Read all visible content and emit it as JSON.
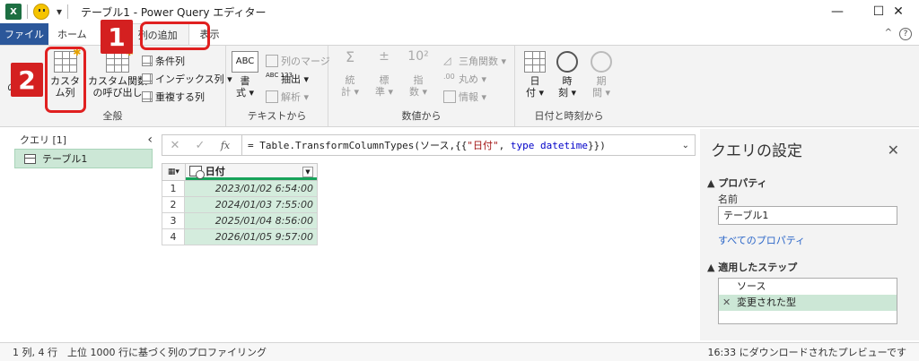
{
  "window": {
    "title": "テーブル1 - Power Query エディター",
    "app_icon_label": "X",
    "minimize": "—",
    "maximize": "☐",
    "close": "✕"
  },
  "tabs": [
    {
      "label": "ファイル"
    },
    {
      "label": "ホーム"
    },
    {
      "label": "列の追加"
    },
    {
      "label": "表示"
    }
  ],
  "ribbon": {
    "general": {
      "label": "全般",
      "col_from_examples_fragment": "の列",
      "custom_column": "カスタ\nム列",
      "invoke_custom_function": "カスタム関数\nの呼び出し",
      "conditional_column": "条件列",
      "index_column": "インデックス列 ▾",
      "duplicate_column": "重複する列"
    },
    "text": {
      "label": "テキストから",
      "format": "書\n式 ▾",
      "merge_columns": "列のマージ",
      "extract": "抽出 ▾",
      "parse": "解析 ▾"
    },
    "number": {
      "label": "数値から",
      "statistics": "統\n計 ▾",
      "standard": "標\n準 ▾",
      "scientific": "指\n数 ▾",
      "trigonometry": "三角関数 ▾",
      "rounding": "丸め ▾",
      "information": "情報 ▾"
    },
    "datetime": {
      "label": "日付と時刻から",
      "date": "日\n付 ▾",
      "time": "時\n刻 ▾",
      "duration": "期\n間 ▾"
    }
  },
  "annotations": {
    "badge1": "1",
    "badge2": "2"
  },
  "queries": {
    "header": "クエリ [1]",
    "collapse": "‹",
    "items": [
      {
        "label": "テーブル1"
      }
    ]
  },
  "formula": {
    "cancel": "✕",
    "confirm": "✓",
    "fx": "fx",
    "prefix": "= Table.TransformColumnTypes(ソース,{{",
    "string": "\"日付\"",
    "mid": ", ",
    "keyword": "type datetime",
    "suffix": "}})",
    "expand": "⌄"
  },
  "table": {
    "column": "日付",
    "rows": [
      {
        "index": "1",
        "value": "2023/01/02 6:54:00"
      },
      {
        "index": "2",
        "value": "2024/01/03 7:55:00"
      },
      {
        "index": "3",
        "value": "2025/01/04 8:56:00"
      },
      {
        "index": "4",
        "value": "2026/01/05 9:57:00"
      }
    ]
  },
  "settings": {
    "title": "クエリの設定",
    "close": "✕",
    "properties_header": "▲ プロパティ",
    "name_label": "名前",
    "name_value": "テーブル1",
    "all_properties": "すべてのプロパティ",
    "steps_header": "▲ 適用したステップ",
    "steps": [
      {
        "label": "ソース"
      },
      {
        "label": "変更された型"
      }
    ]
  },
  "status": {
    "left": "1 列, 4 行　上位 1000 行に基づく列のプロファイリング",
    "right": "16:33 にダウンロードされたプレビューです"
  },
  "colors": {
    "accent_blue": "#2b579a",
    "green_selection": "#cce7d6",
    "annotation_red": "#d42020"
  }
}
